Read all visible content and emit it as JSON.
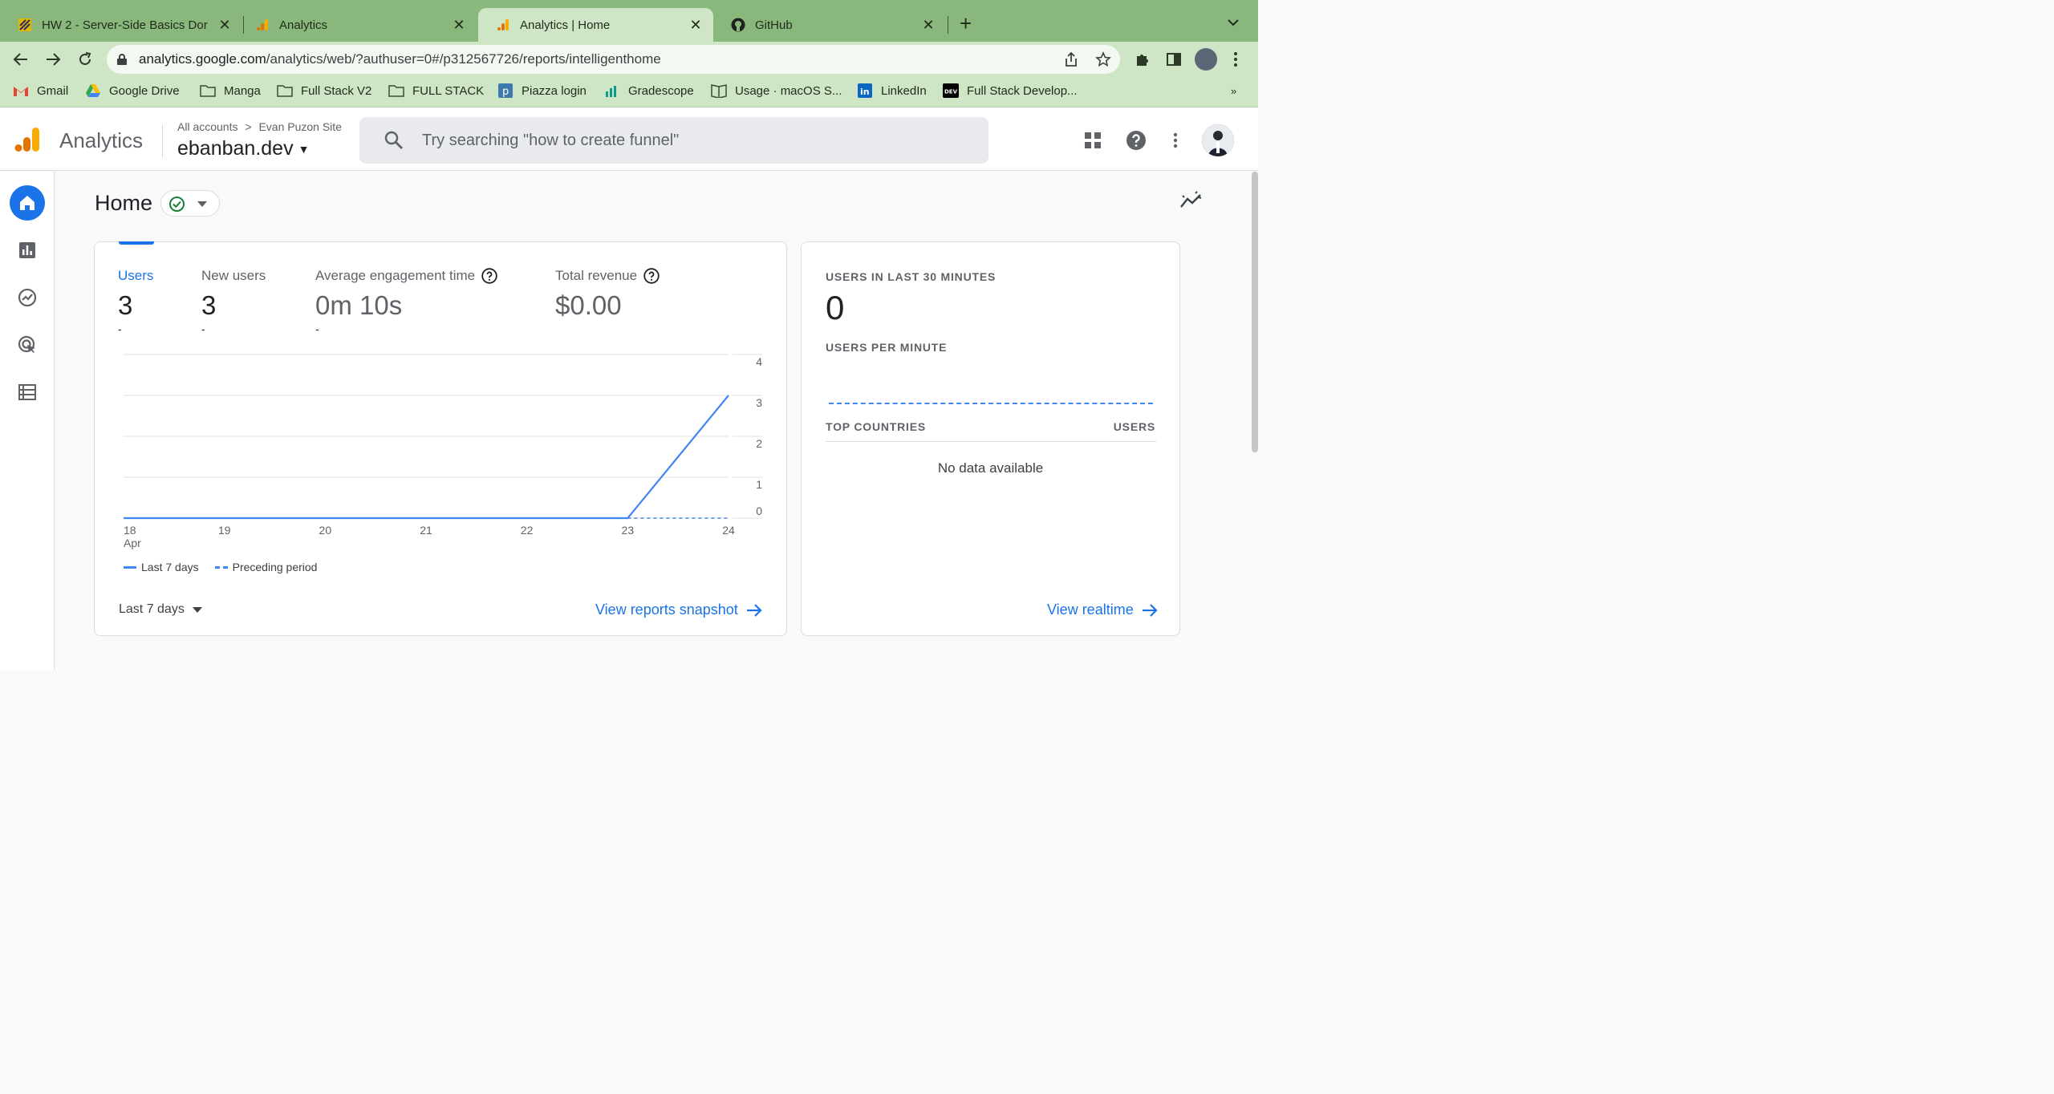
{
  "browser": {
    "tabs": [
      {
        "title": "HW 2 - Server-Side Basics Dor",
        "active": false
      },
      {
        "title": "Analytics",
        "active": false
      },
      {
        "title": "Analytics | Home",
        "active": true
      },
      {
        "title": "GitHub",
        "active": false
      }
    ],
    "url_host": "analytics.google.com",
    "url_path": "/analytics/web/?authuser=0#/p312567726/reports/intelligenthome",
    "bookmarks": [
      "Gmail",
      "Google Drive",
      "Manga",
      "Full Stack V2",
      "FULL STACK",
      "Piazza login",
      "Gradescope",
      "Usage · macOS S...",
      "LinkedIn",
      "Full Stack Develop..."
    ]
  },
  "header": {
    "app_name": "Analytics",
    "breadcrumb_accounts": "All accounts",
    "breadcrumb_separator": ">",
    "breadcrumb_site": "Evan Puzon Site",
    "property": "ebanban.dev",
    "search_placeholder": "Try searching \"how to create funnel\""
  },
  "page": {
    "title": "Home"
  },
  "metrics": [
    {
      "label": "Users",
      "value": "3",
      "delta": "-"
    },
    {
      "label": "New users",
      "value": "3",
      "delta": "-"
    },
    {
      "label": "Average engagement time",
      "value": "0m 10s",
      "delta": "-"
    },
    {
      "label": "Total revenue",
      "value": "$0.00",
      "delta": ""
    }
  ],
  "chart_data": {
    "type": "line",
    "x": [
      "18",
      "19",
      "20",
      "21",
      "22",
      "23",
      "24"
    ],
    "x_sublabel_first": "Apr",
    "series": [
      {
        "name": "Last 7 days",
        "values": [
          0,
          0,
          0,
          0,
          0,
          0,
          3
        ],
        "style": "solid",
        "color": "#4285f4"
      },
      {
        "name": "Preceding period",
        "values": [
          0,
          0,
          0,
          0,
          0,
          0,
          0
        ],
        "style": "dashed",
        "color": "#4285f4"
      }
    ],
    "y_ticks": [
      0,
      1,
      2,
      3,
      4
    ],
    "ylim": [
      0,
      4
    ],
    "grid": true,
    "legend_position": "bottom-left"
  },
  "card1": {
    "range_label": "Last 7 days",
    "link": "View reports snapshot"
  },
  "realtime": {
    "heading": "USERS IN LAST 30 MINUTES",
    "count": "0",
    "per_minute": "USERS PER MINUTE",
    "countries_col": "TOP COUNTRIES",
    "users_col": "USERS",
    "empty": "No data available",
    "link": "View realtime"
  },
  "colors": {
    "accent": "#1a73e8",
    "series": "#4285f4",
    "chrome": "#8ab87c"
  }
}
